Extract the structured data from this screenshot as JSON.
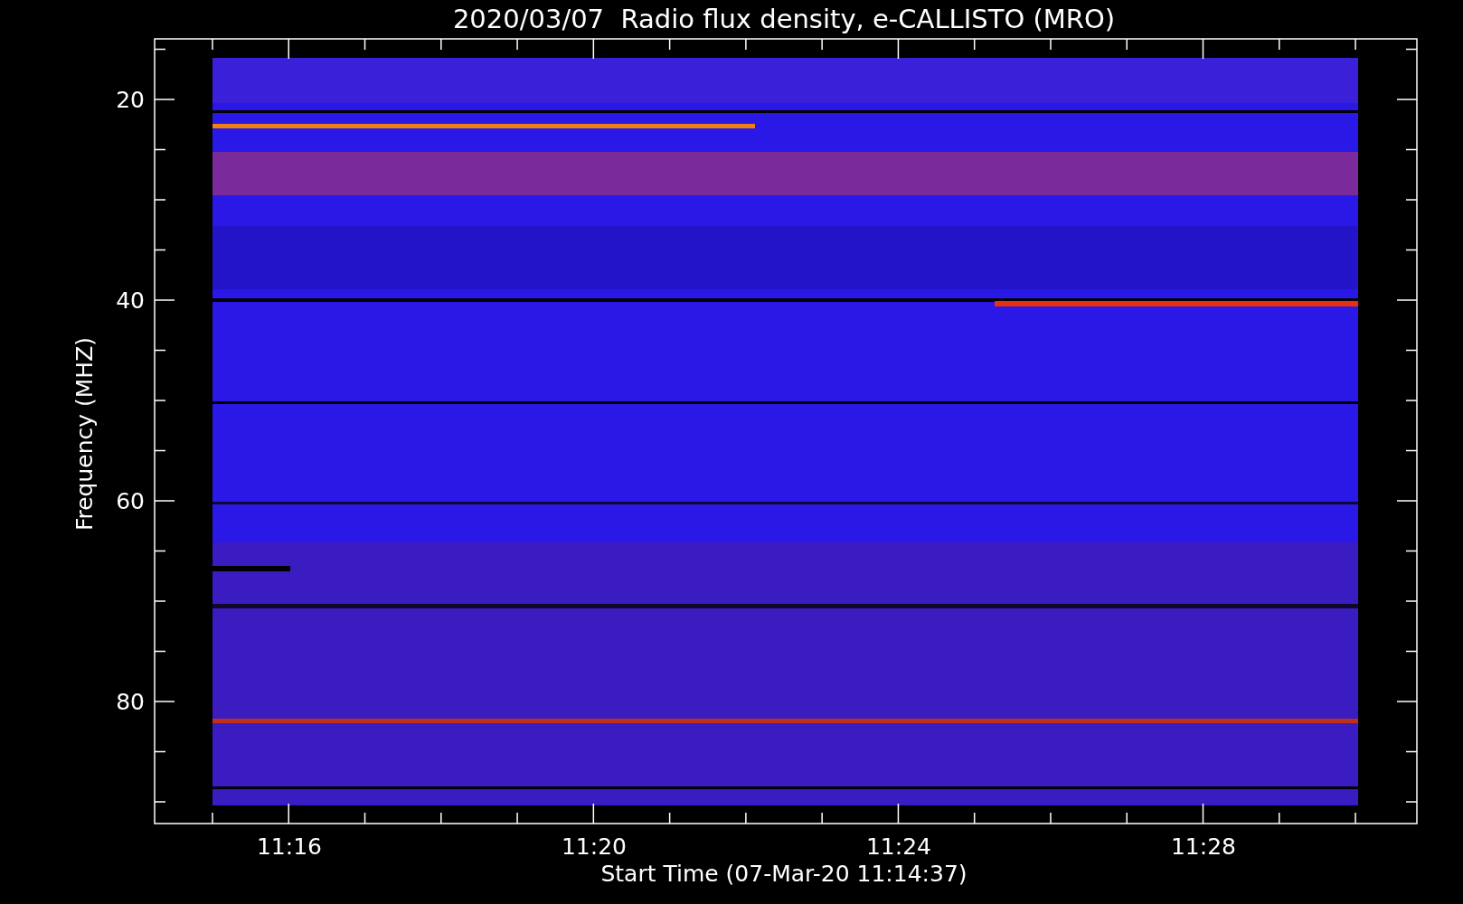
{
  "plot": {
    "title": "2020/03/07  Radio flux density, e-CALLISTO (MRO)",
    "xlabel": "Start Time (07-Mar-20 11:14:37)",
    "ylabel": "Frequency (MHZ)",
    "xticks": [
      "11:16",
      "11:20",
      "11:24",
      "11:28"
    ],
    "yticks": [
      "20",
      "40",
      "60",
      "80"
    ]
  }
}
